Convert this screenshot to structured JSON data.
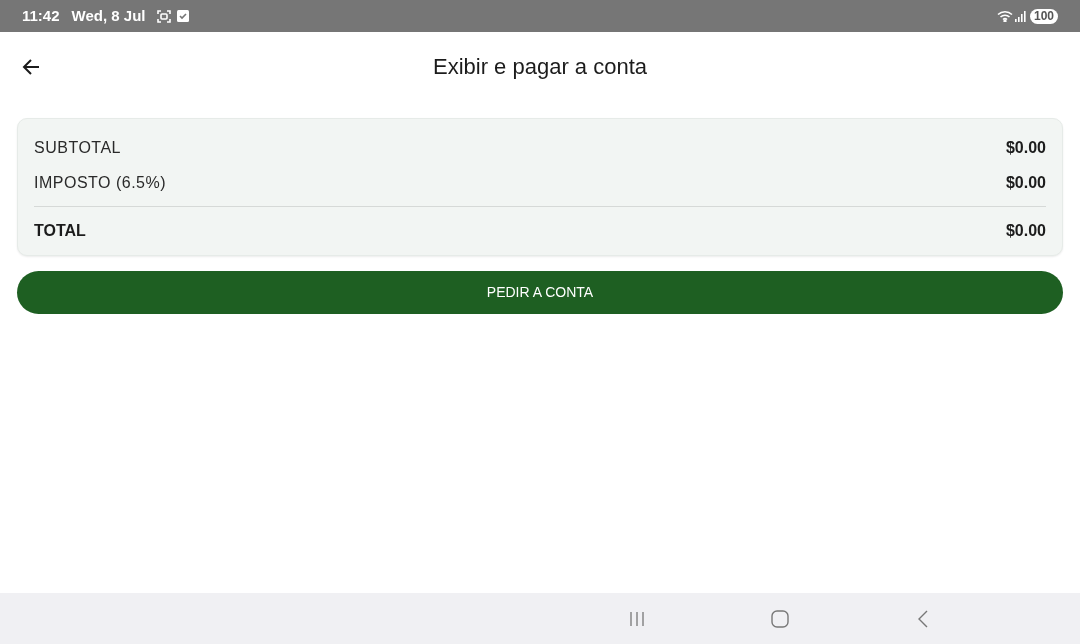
{
  "status_bar": {
    "time": "11:42",
    "date": "Wed, 8 Jul",
    "battery": "100"
  },
  "header": {
    "title": "Exibir e pagar a conta"
  },
  "summary": {
    "rows": [
      {
        "kind": "normal",
        "label": "SUBTOTAL",
        "value": "$0.00"
      },
      {
        "kind": "normal",
        "label": "IMPOSTO (6.5%)",
        "value": "$0.00"
      },
      {
        "kind": "total",
        "label": "TOTAL",
        "value": "$0.00"
      }
    ]
  },
  "button": {
    "label": "PEDIR A CONTA"
  }
}
